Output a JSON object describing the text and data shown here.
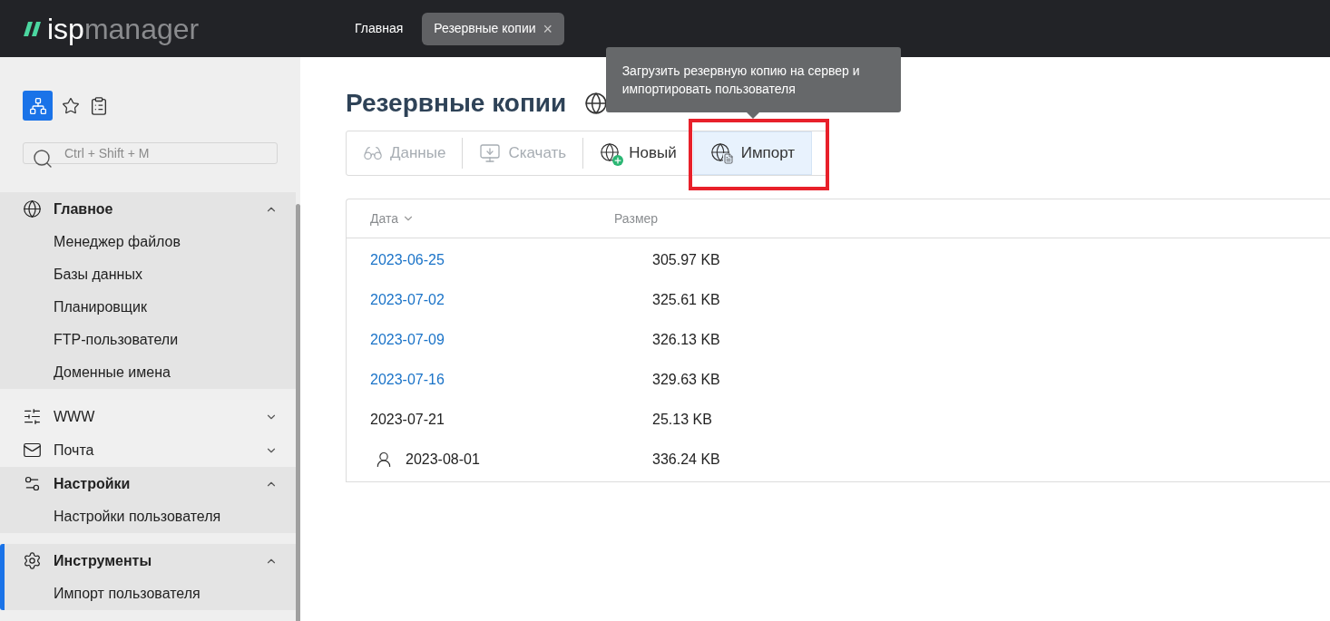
{
  "header": {
    "logo": {
      "part_1": "isp",
      "part_2": "manager"
    },
    "tabs": [
      {
        "label": "Главная",
        "selected": false
      },
      {
        "label": "Резервные копии",
        "selected": true,
        "close": "×"
      }
    ]
  },
  "sidebar": {
    "search": {
      "placeholder": "Ctrl + Shift + M"
    },
    "groups": [
      {
        "label": "Главное",
        "expanded": true,
        "selected": false,
        "children": [
          {
            "label": "Менеджер файлов"
          },
          {
            "label": "Базы данных"
          },
          {
            "label": "Планировщик"
          },
          {
            "label": "FTP-пользователи"
          },
          {
            "label": "Доменные имена"
          }
        ]
      },
      {
        "label": "WWW",
        "expanded": false,
        "selected": false
      },
      {
        "label": "Почта",
        "expanded": false,
        "selected": false
      },
      {
        "label": "Настройки",
        "expanded": true,
        "selected": false,
        "children": [
          {
            "label": "Настройки пользователя"
          }
        ]
      },
      {
        "label": "Инструменты",
        "expanded": true,
        "selected": true,
        "children": [
          {
            "label": "Импорт пользователя"
          }
        ]
      }
    ]
  },
  "page": {
    "title": "Резервные копии",
    "toolbar": [
      {
        "label": "Данные",
        "disabled": true,
        "active": false
      },
      {
        "label": "Скачать",
        "disabled": true,
        "active": false
      },
      {
        "label": "Новый",
        "disabled": false,
        "active": false
      },
      {
        "label": "Импорт",
        "disabled": false,
        "active": true
      }
    ],
    "tooltip": "Загрузить резервную копию на сервер и импортировать пользователя",
    "table": {
      "columns": [
        {
          "label": "Дата",
          "sorted": true
        },
        {
          "label": "Размер",
          "sorted": false
        }
      ],
      "rows": [
        {
          "date": "2023-06-25",
          "size": "305.97 KB",
          "kind": "link"
        },
        {
          "date": "2023-07-02",
          "size": "325.61 KB",
          "kind": "link"
        },
        {
          "date": "2023-07-09",
          "size": "326.13 KB",
          "kind": "link"
        },
        {
          "date": "2023-07-16",
          "size": "329.63 KB",
          "kind": "link"
        },
        {
          "date": "2023-07-21",
          "size": "25.13 KB",
          "kind": "plain"
        },
        {
          "date": "2023-08-01",
          "size": "336.24 KB",
          "kind": "user"
        }
      ]
    }
  }
}
